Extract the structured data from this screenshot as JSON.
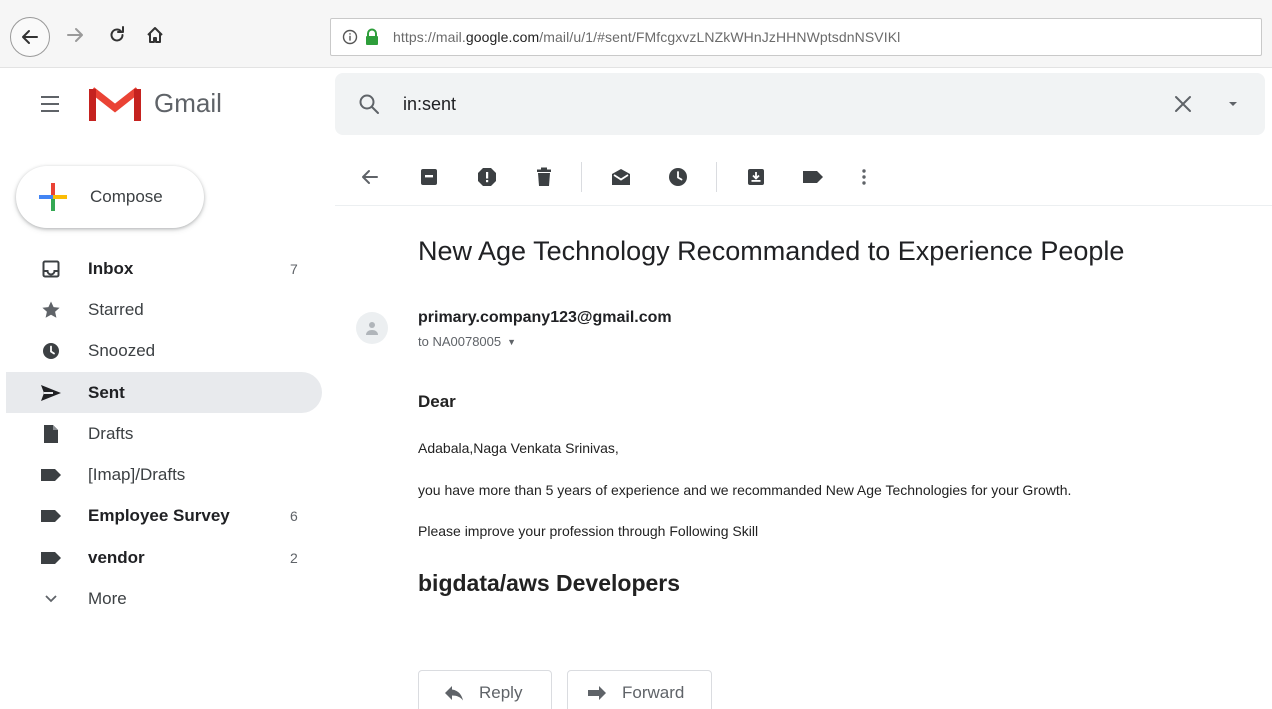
{
  "browser": {
    "url_prefix": "https://mail.",
    "url_domain": "google.com",
    "url_suffix": "/mail/u/1/#sent/FMfcgxvzLNZkWHnJzHHNWptsdnNSVIKl"
  },
  "header": {
    "app_name": "Gmail",
    "search_value": "in:sent"
  },
  "sidebar": {
    "compose_label": "Compose",
    "items": [
      {
        "label": "Inbox",
        "count": "7",
        "icon": "inbox-icon"
      },
      {
        "label": "Starred",
        "count": "",
        "icon": "star-icon"
      },
      {
        "label": "Snoozed",
        "count": "",
        "icon": "clock-icon"
      },
      {
        "label": "Sent",
        "count": "",
        "icon": "send-icon"
      },
      {
        "label": "Drafts",
        "count": "",
        "icon": "draft-icon"
      },
      {
        "label": "[Imap]/Drafts",
        "count": "",
        "icon": "label-icon"
      },
      {
        "label": "Employee Survey",
        "count": "6",
        "icon": "label-icon"
      },
      {
        "label": "vendor",
        "count": "2",
        "icon": "label-icon"
      },
      {
        "label": "More",
        "count": "",
        "icon": "chevron-down-icon"
      }
    ]
  },
  "message": {
    "subject": "New Age Technology Recommanded to Experience People",
    "sender": "primary.company123@gmail.com",
    "recipient": "to NA0078005",
    "greeting": "Dear",
    "lines": [
      "Adabala,Naga Venkata Srinivas,",
      "you have more than 5 years of experience and we recommanded New Age Technologies for your Growth.",
      "Please improve your profession through Following Skill"
    ],
    "skill": "bigdata/aws Developers"
  },
  "actions": {
    "reply_label": "Reply",
    "forward_label": "Forward"
  },
  "colors": {
    "gmail_red": "#ea4335",
    "active_nav_bg": "#e8eaed",
    "search_bg": "#f1f3f4",
    "lock_green": "#2e9e3b"
  }
}
